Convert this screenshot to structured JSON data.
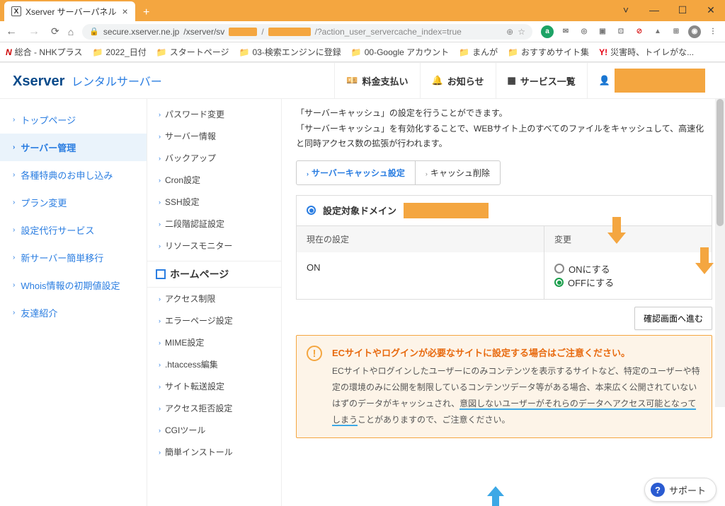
{
  "window": {
    "tab_title": "Xserver サーバーパネル",
    "url_host": "secure.xserver.ne.jp",
    "url_path_prefix": "/xserver/sv",
    "url_path_suffix": "/?action_user_servercache_index=true"
  },
  "bookmarks": [
    {
      "label": "総合 - NHKプラス",
      "icon": "N",
      "color": "#cc0000"
    },
    {
      "label": "2022_日付",
      "folder": true
    },
    {
      "label": "スタートページ",
      "folder": true
    },
    {
      "label": "03-検索エンジンに登録",
      "folder": true
    },
    {
      "label": "00-Google アカウント",
      "folder": true
    },
    {
      "label": "まんが",
      "folder": true
    },
    {
      "label": "おすすめサイト集",
      "folder": true
    },
    {
      "label": "災害時、トイレがな...",
      "icon": "Y!",
      "color": "#e60012"
    }
  ],
  "header": {
    "logo_x": "X",
    "logo_server": "server",
    "logo_rental": "レンタルサーバー",
    "pay": "料金支払い",
    "notice": "お知らせ",
    "services": "サービス一覧"
  },
  "leftnav": [
    "トップページ",
    "サーバー管理",
    "各種特典のお申し込み",
    "プラン変更",
    "設定代行サービス",
    "新サーバー簡単移行",
    "Whois情報の初期値設定",
    "友達紹介"
  ],
  "leftnav_active_index": 1,
  "midnav_top": [
    "パスワード変更",
    "サーバー情報",
    "バックアップ",
    "Cron設定",
    "SSH設定",
    "二段階認証設定",
    "リソースモニター"
  ],
  "midnav_section": "ホームページ",
  "midnav_bottom": [
    "アクセス制限",
    "エラーページ設定",
    "MIME設定",
    ".htaccess編集",
    "サイト転送設定",
    "アクセス拒否設定",
    "CGIツール",
    "簡単インストール"
  ],
  "main": {
    "desc1": "「サーバーキャッシュ」の設定を行うことができます。",
    "desc2": "「サーバーキャッシュ」を有効化することで、WEBサイト上のすべてのファイルをキャッシュして、高速化と同時アクセス数の拡張が行われます。",
    "tab1": "サーバーキャッシュ設定",
    "tab2": "キャッシュ削除",
    "domain_label": "設定対象ドメイン",
    "col_current": "現在の設定",
    "col_change": "変更",
    "current_value": "ON",
    "opt_on": "ONにする",
    "opt_off": "OFFにする",
    "confirm_btn": "確認画面へ進む",
    "warn_title": "ECサイトやログインが必要なサイトに設定する場合はご注意ください。",
    "warn_body_1": "ECサイトやログインしたユーザーにのみコンテンツを表示するサイトなど、特定のユーザーや特定の環境のみに公開を制限しているコンテンツデータ等がある場合、本来広く公開されていないはずのデータがキャッシュされ、",
    "warn_body_underlined": "意図しないユーザーがそれらのデータへアクセス可能となってしまう",
    "warn_body_2": "ことがありますので、ご注意ください。",
    "support": "サポート"
  }
}
